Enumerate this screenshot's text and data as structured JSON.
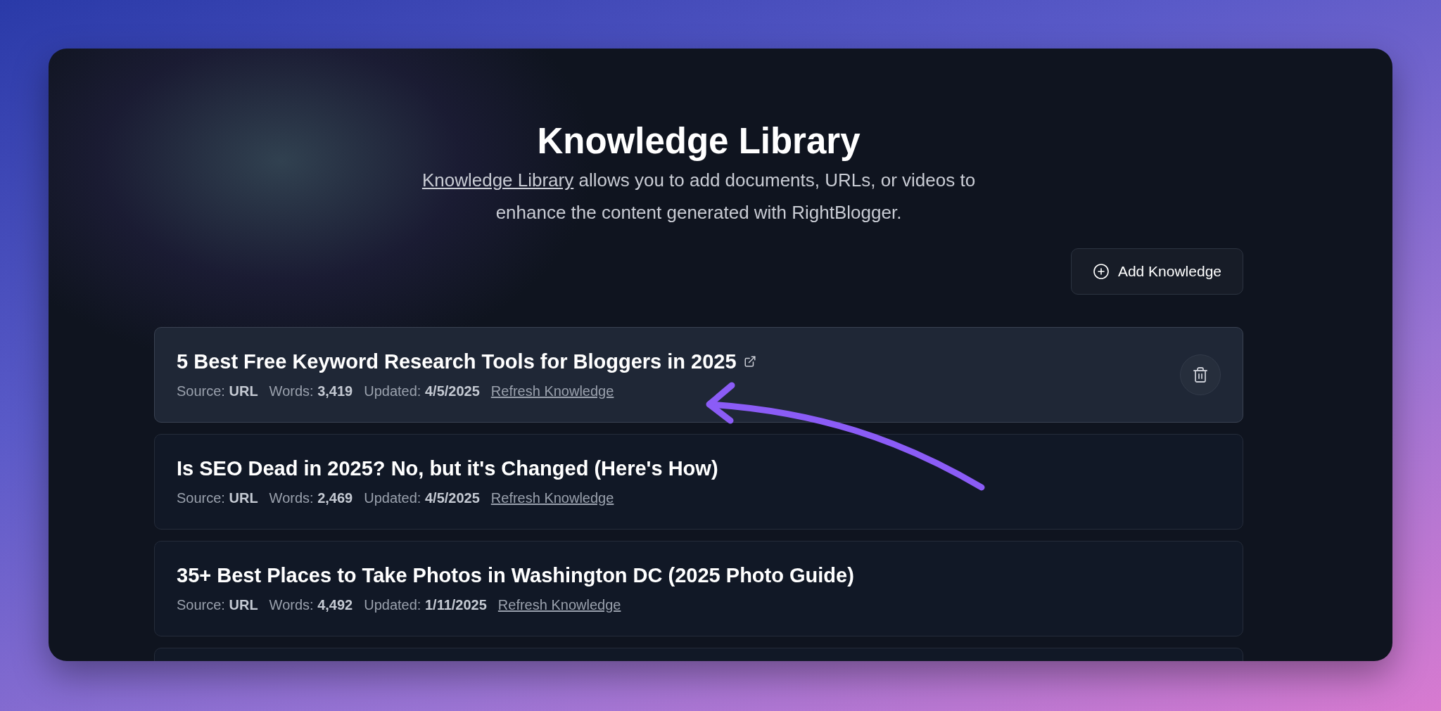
{
  "header": {
    "title": "Knowledge Library",
    "description_link": "Knowledge Library",
    "description": " allows you to add documents, URLs, or videos to enhance the content generated with RightBlogger."
  },
  "add_button": {
    "label": "Add Knowledge"
  },
  "items": [
    {
      "title": "5 Best Free Keyword Research Tools for Bloggers in 2025",
      "selected": true,
      "source_label": "Source:",
      "source": "URL",
      "words_label": "Words:",
      "words": "3,419",
      "updated_label": "Updated:",
      "updated": "4/5/2025",
      "refresh": "Refresh Knowledge"
    },
    {
      "title": "Is SEO Dead in 2025? No, but it's Changed (Here's How)",
      "selected": false,
      "source_label": "Source:",
      "source": "URL",
      "words_label": "Words:",
      "words": "2,469",
      "updated_label": "Updated:",
      "updated": "4/5/2025",
      "refresh": "Refresh Knowledge"
    },
    {
      "title": "35+ Best Places to Take Photos in Washington DC (2025 Photo Guide)",
      "selected": false,
      "source_label": "Source:",
      "source": "URL",
      "words_label": "Words:",
      "words": "4,492",
      "updated_label": "Updated:",
      "updated": "1/11/2025",
      "refresh": "Refresh Knowledge"
    }
  ],
  "more_items_below": true,
  "annotation": {
    "kind": "arrow",
    "color": "#8b5cf6"
  }
}
